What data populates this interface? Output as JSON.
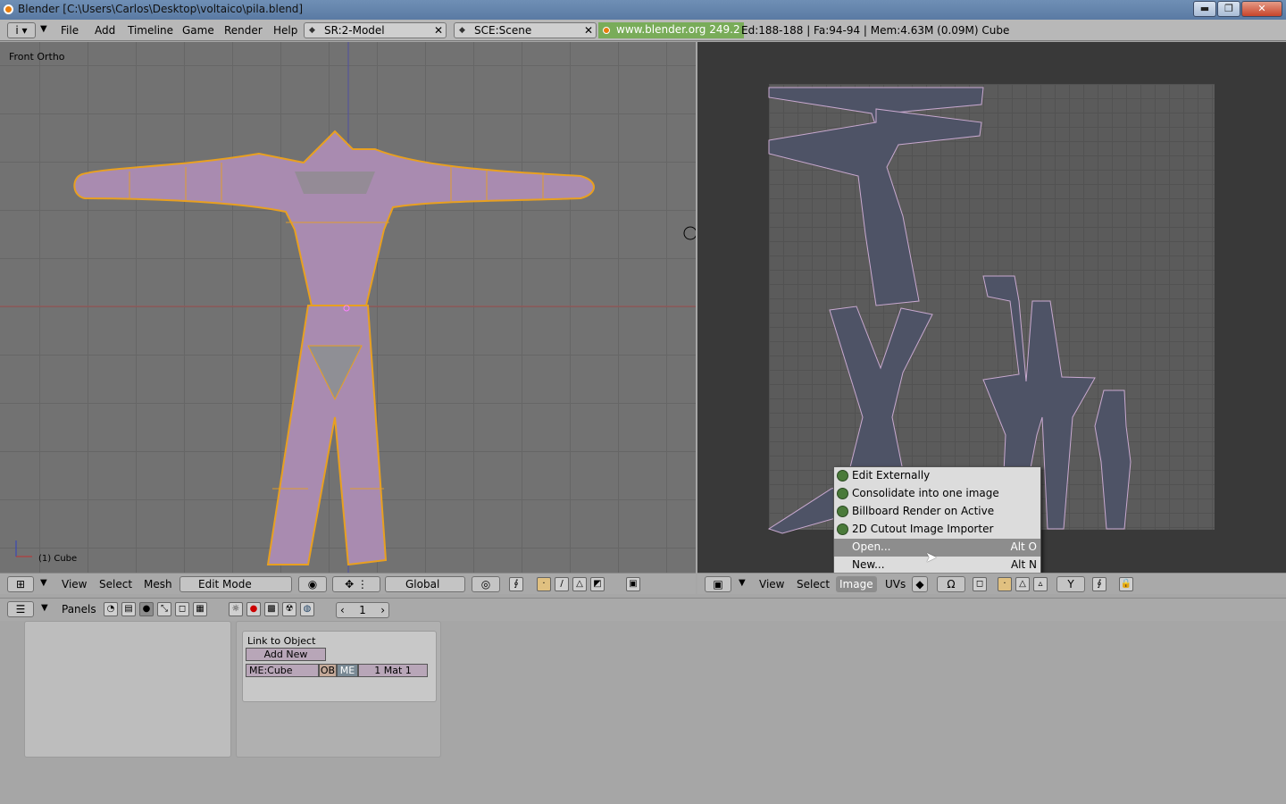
{
  "window": {
    "title": "Blender [C:\\Users\\Carlos\\Desktop\\voltaico\\pila.blend]",
    "minimize": "▬",
    "maximize": "❐",
    "close": "✕"
  },
  "topbar": {
    "menus": [
      "File",
      "Add",
      "Timeline",
      "Game",
      "Render",
      "Help"
    ],
    "screen_field": "SR:2-Model",
    "scene_field": "SCE:Scene",
    "url": "www.blender.org 249.2",
    "stats": "Ed:188-188 | Fa:94-94 | Mem:4.63M (0.09M) Cube"
  },
  "view3d": {
    "view_label": "Front Ortho",
    "object_label": "(1) Cube",
    "header": {
      "menus": [
        "View",
        "Select",
        "Mesh"
      ],
      "mode": "Edit Mode",
      "orientation": "Global"
    }
  },
  "uv_editor": {
    "header": {
      "menus": [
        "View",
        "Select",
        "Image",
        "UVs"
      ],
      "active_menu": "Image"
    },
    "popup": {
      "items": [
        {
          "label": "Edit Externally",
          "shortcut": ""
        },
        {
          "label": "Consolidate into one image",
          "shortcut": ""
        },
        {
          "label": "Billboard Render on Active",
          "shortcut": ""
        },
        {
          "label": "2D Cutout Image Importer",
          "shortcut": ""
        },
        {
          "label": "Open...",
          "shortcut": "Alt O"
        },
        {
          "label": "New...",
          "shortcut": "Alt N"
        }
      ],
      "highlighted": "Open..."
    }
  },
  "buttons_window": {
    "header": {
      "panels_label": "Panels",
      "frame": "1"
    },
    "link_panel": {
      "title": "Link to Object",
      "add_new": "Add New",
      "mesh_name": "ME:Cube",
      "ob": "OB",
      "me": "ME",
      "mat": "1 Mat 1"
    }
  },
  "colors": {
    "mesh": "#a98bb0",
    "edge_selected": "#e8a020",
    "uv_face": "#4e5366",
    "url_bg": "#79ac59"
  }
}
